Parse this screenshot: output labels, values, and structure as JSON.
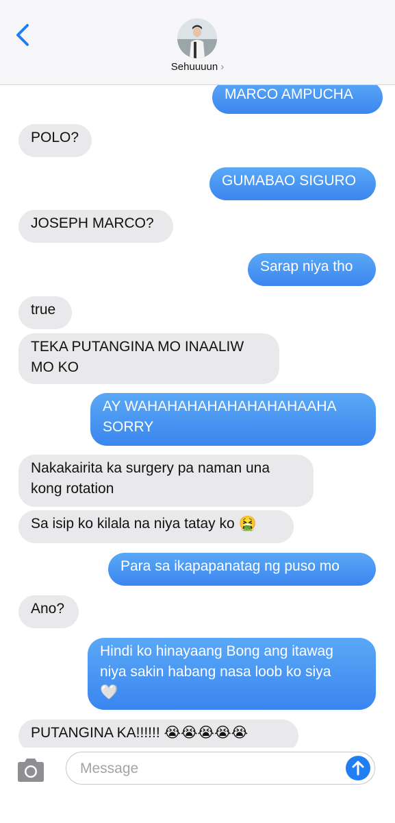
{
  "header": {
    "contact_name": "Sehuuuun",
    "chevron": "›",
    "back_icon": "chevron-left-icon",
    "avatar": "contact-photo"
  },
  "messages": [
    {
      "side": "sent",
      "text": "MARCO AMPUCHA"
    },
    {
      "side": "received",
      "text": "POLO?"
    },
    {
      "side": "sent",
      "text": "GUMABAO SIGURO"
    },
    {
      "side": "received",
      "text": "JOSEPH MARCO?"
    },
    {
      "side": "sent",
      "text": "Sarap niya tho"
    },
    {
      "side": "received",
      "text": "true"
    },
    {
      "side": "received",
      "text": "TEKA PUTANGINA MO INAALIW\nMO KO"
    },
    {
      "side": "sent",
      "text": "AY WAHAHAHAHAHAHAHAHAAHA\nSORRY"
    },
    {
      "side": "received",
      "text": "Nakakairita ka surgery pa naman una\nkong rotation"
    },
    {
      "side": "received",
      "text": "Sa isip ko kilala na niya tatay ko 🤮"
    },
    {
      "side": "sent",
      "text": "Para sa ikapapanatag ng puso mo"
    },
    {
      "side": "received",
      "text": "Ano?"
    },
    {
      "side": "sent",
      "text": "Hindi ko hinayaang Bong ang itawag\nniya sakin habang nasa loob ko siya\n🤍"
    },
    {
      "side": "received",
      "text": "PUTANGINA KA!!!!!! 😭😭😭😭😭"
    }
  ],
  "composer": {
    "placeholder": "Message",
    "camera_icon": "camera-icon",
    "send_icon": "send-arrow-icon"
  },
  "colors": {
    "sent_bubble": "#3a86ef",
    "received_bubble": "#e9e9eb",
    "accent": "#1f7ef1"
  }
}
